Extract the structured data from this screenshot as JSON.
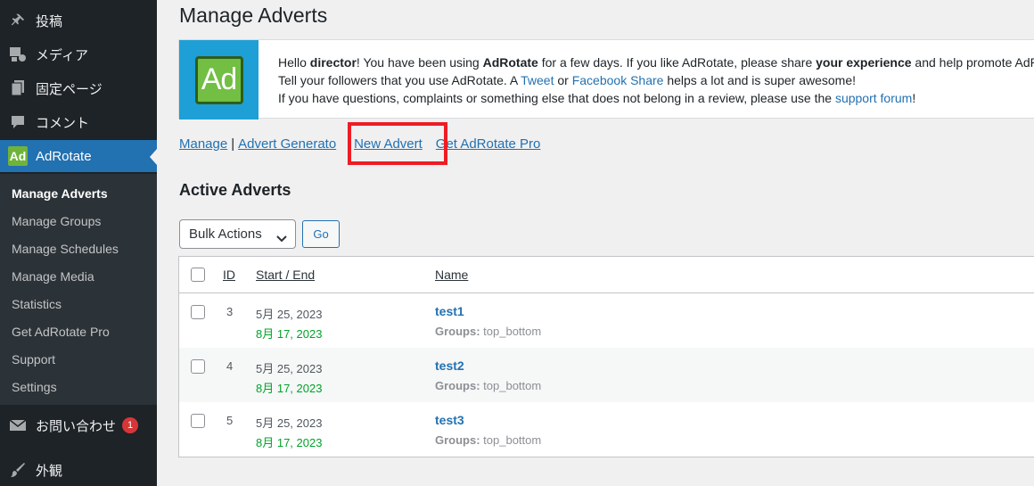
{
  "sidebar": {
    "items": [
      {
        "label": "投稿",
        "icon": "pin-icon"
      },
      {
        "label": "メディア",
        "icon": "media-icon"
      },
      {
        "label": "固定ページ",
        "icon": "pages-icon"
      },
      {
        "label": "コメント",
        "icon": "comment-icon"
      },
      {
        "label": "AdRotate",
        "icon": "adrotate-icon",
        "icon_text": "Ad"
      }
    ],
    "submenu": [
      "Manage Adverts",
      "Manage Groups",
      "Manage Schedules",
      "Manage Media",
      "Statistics",
      "Get AdRotate Pro",
      "Support",
      "Settings"
    ],
    "contact": {
      "label": "お問い合わせ",
      "badge": "1"
    },
    "appearance": {
      "label": "外観"
    }
  },
  "page": {
    "title": "Manage Adverts"
  },
  "notice": {
    "logo_text": "Ad",
    "line1": {
      "pre": "Hello ",
      "user": "director",
      "mid": "! You have been using ",
      "plugin": "AdRotate",
      "mid2": " for a few days. If you like AdRotate, please share ",
      "bold2": "your experience",
      "post": " and help promote AdR"
    },
    "line2": {
      "pre": "Tell your followers that you use AdRotate. A ",
      "tweet": "Tweet",
      "or": " or ",
      "fb": "Facebook Share",
      "post": " helps a lot and is super awesome!"
    },
    "line3": {
      "pre": "If you have questions, complaints or something else that does not belong in a review, please use the ",
      "link": "support forum",
      "post": "!"
    }
  },
  "links": {
    "manage": "Manage",
    "generator": "Advert Generato",
    "new": "New Advert",
    "pro": "Get AdRotate Pro",
    "sep": "|"
  },
  "section_title": "Active Adverts",
  "bulk": {
    "label": "Bulk Actions",
    "go": "Go"
  },
  "table": {
    "headers": {
      "id": "ID",
      "dates": "Start / End",
      "name": "Name"
    },
    "rows": [
      {
        "id": "3",
        "start": "5月 25, 2023",
        "end": "8月 17, 2023",
        "name": "test1",
        "groups_label": "Groups:",
        "groups": " top_bottom"
      },
      {
        "id": "4",
        "start": "5月 25, 2023",
        "end": "8月 17, 2023",
        "name": "test2",
        "groups_label": "Groups:",
        "groups": " top_bottom"
      },
      {
        "id": "5",
        "start": "5月 25, 2023",
        "end": "8月 17, 2023",
        "name": "test3",
        "groups_label": "Groups:",
        "groups": " top_bottom"
      }
    ]
  },
  "colors": {
    "sidebar_bg": "#1d2327",
    "active_bg": "#2271b1",
    "link": "#2271b1",
    "highlight": "#ee1c24",
    "end_date": "#00a32a"
  }
}
